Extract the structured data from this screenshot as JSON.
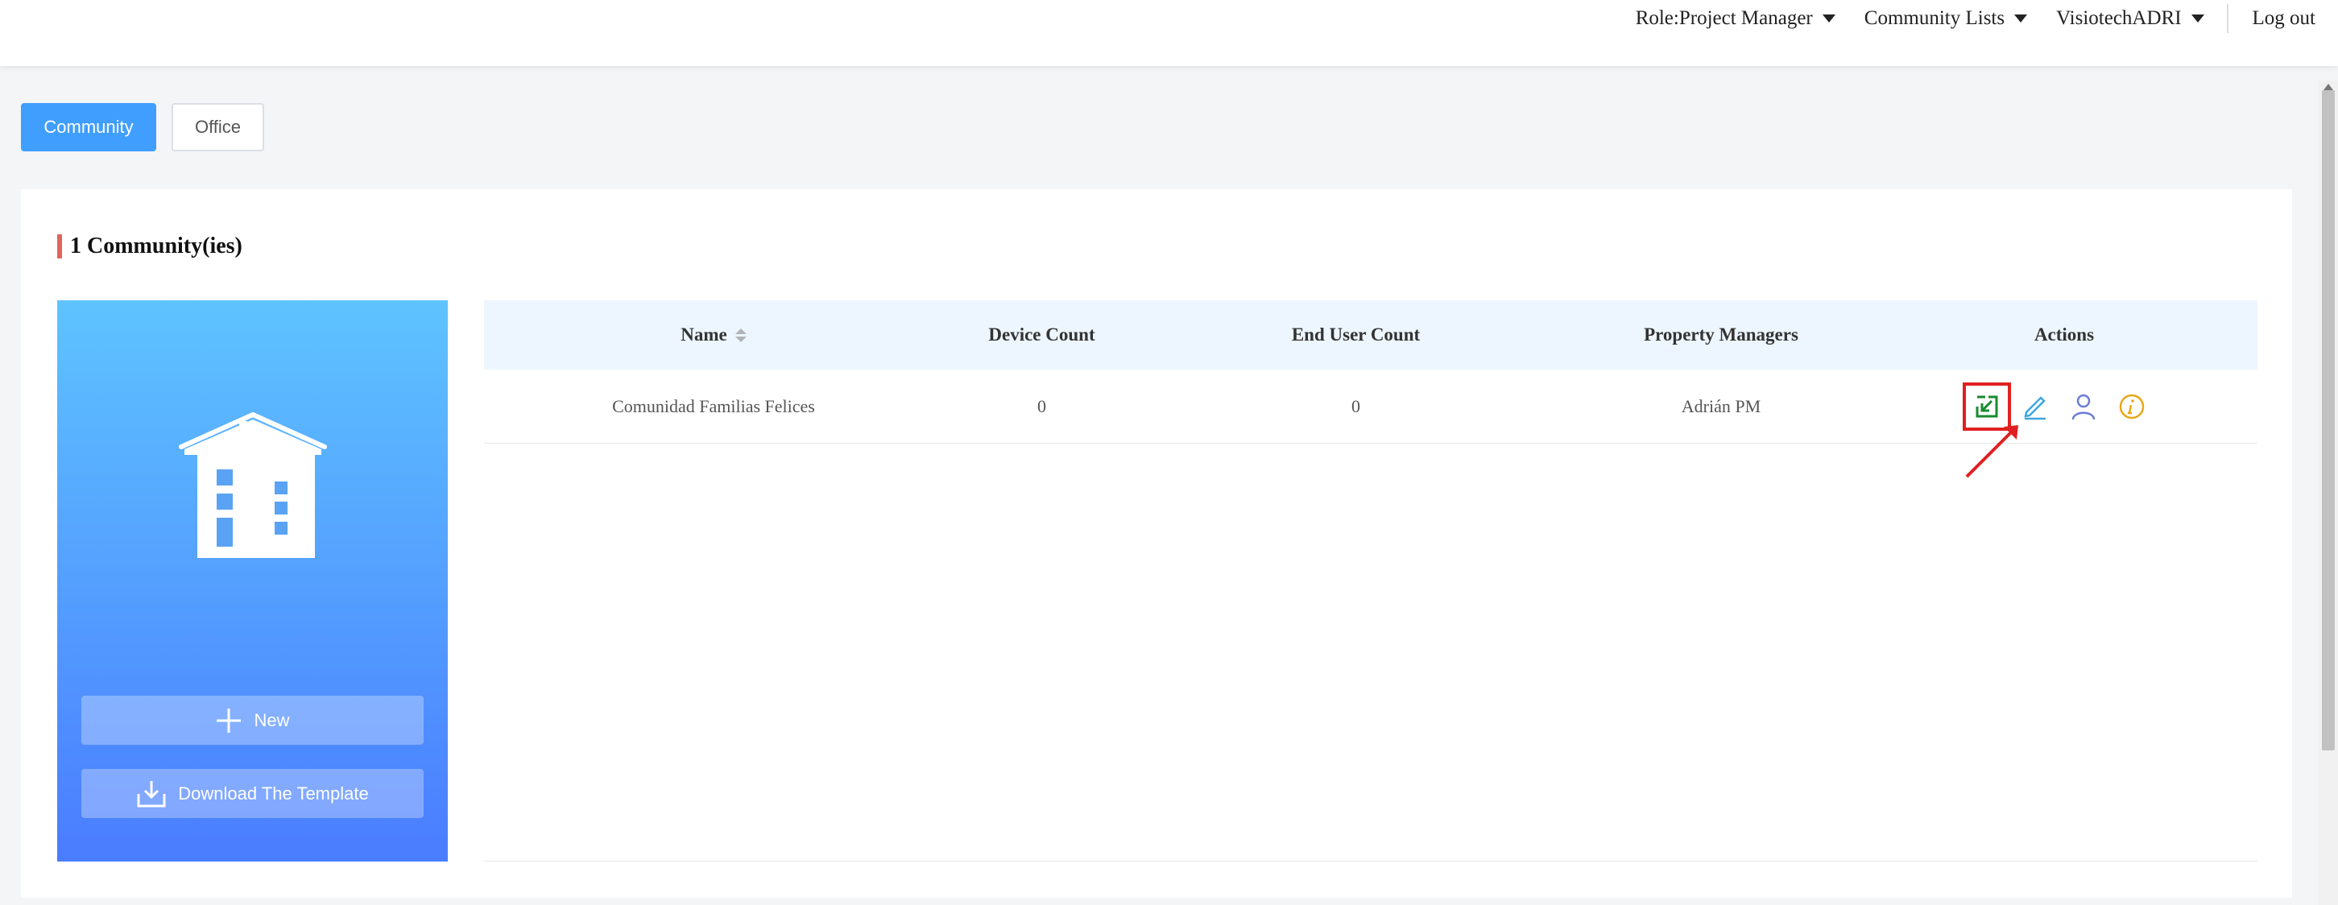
{
  "header": {
    "role_label": "Role:Project Manager",
    "community_lists_label": "Community Lists",
    "account_label": "VisiotechADRI",
    "logout_label": "Log out"
  },
  "tabs": [
    {
      "label": "Community",
      "active": true
    },
    {
      "label": "Office",
      "active": false
    }
  ],
  "panel": {
    "title": "1 Community(ies)"
  },
  "side_card": {
    "new_label": "New",
    "download_label": "Download The Template"
  },
  "table": {
    "columns": [
      "Name",
      "Device Count",
      "End User Count",
      "Property Managers",
      "Actions"
    ],
    "rows": [
      {
        "name": "Comunidad Familias Felices",
        "device_count": "0",
        "end_user_count": "0",
        "property_managers": "Adrián PM",
        "actions": [
          "enter-community-icon",
          "edit-icon",
          "user-icon",
          "info-icon"
        ]
      }
    ]
  },
  "colors": {
    "primary": "#409eff",
    "accent_bar": "#e0645a",
    "highlight_box": "#e02020",
    "enter_icon": "#1a8a2e",
    "edit_icon": "#3fa6e0",
    "user_icon": "#6a7dd6",
    "info_icon": "#e6a817"
  }
}
